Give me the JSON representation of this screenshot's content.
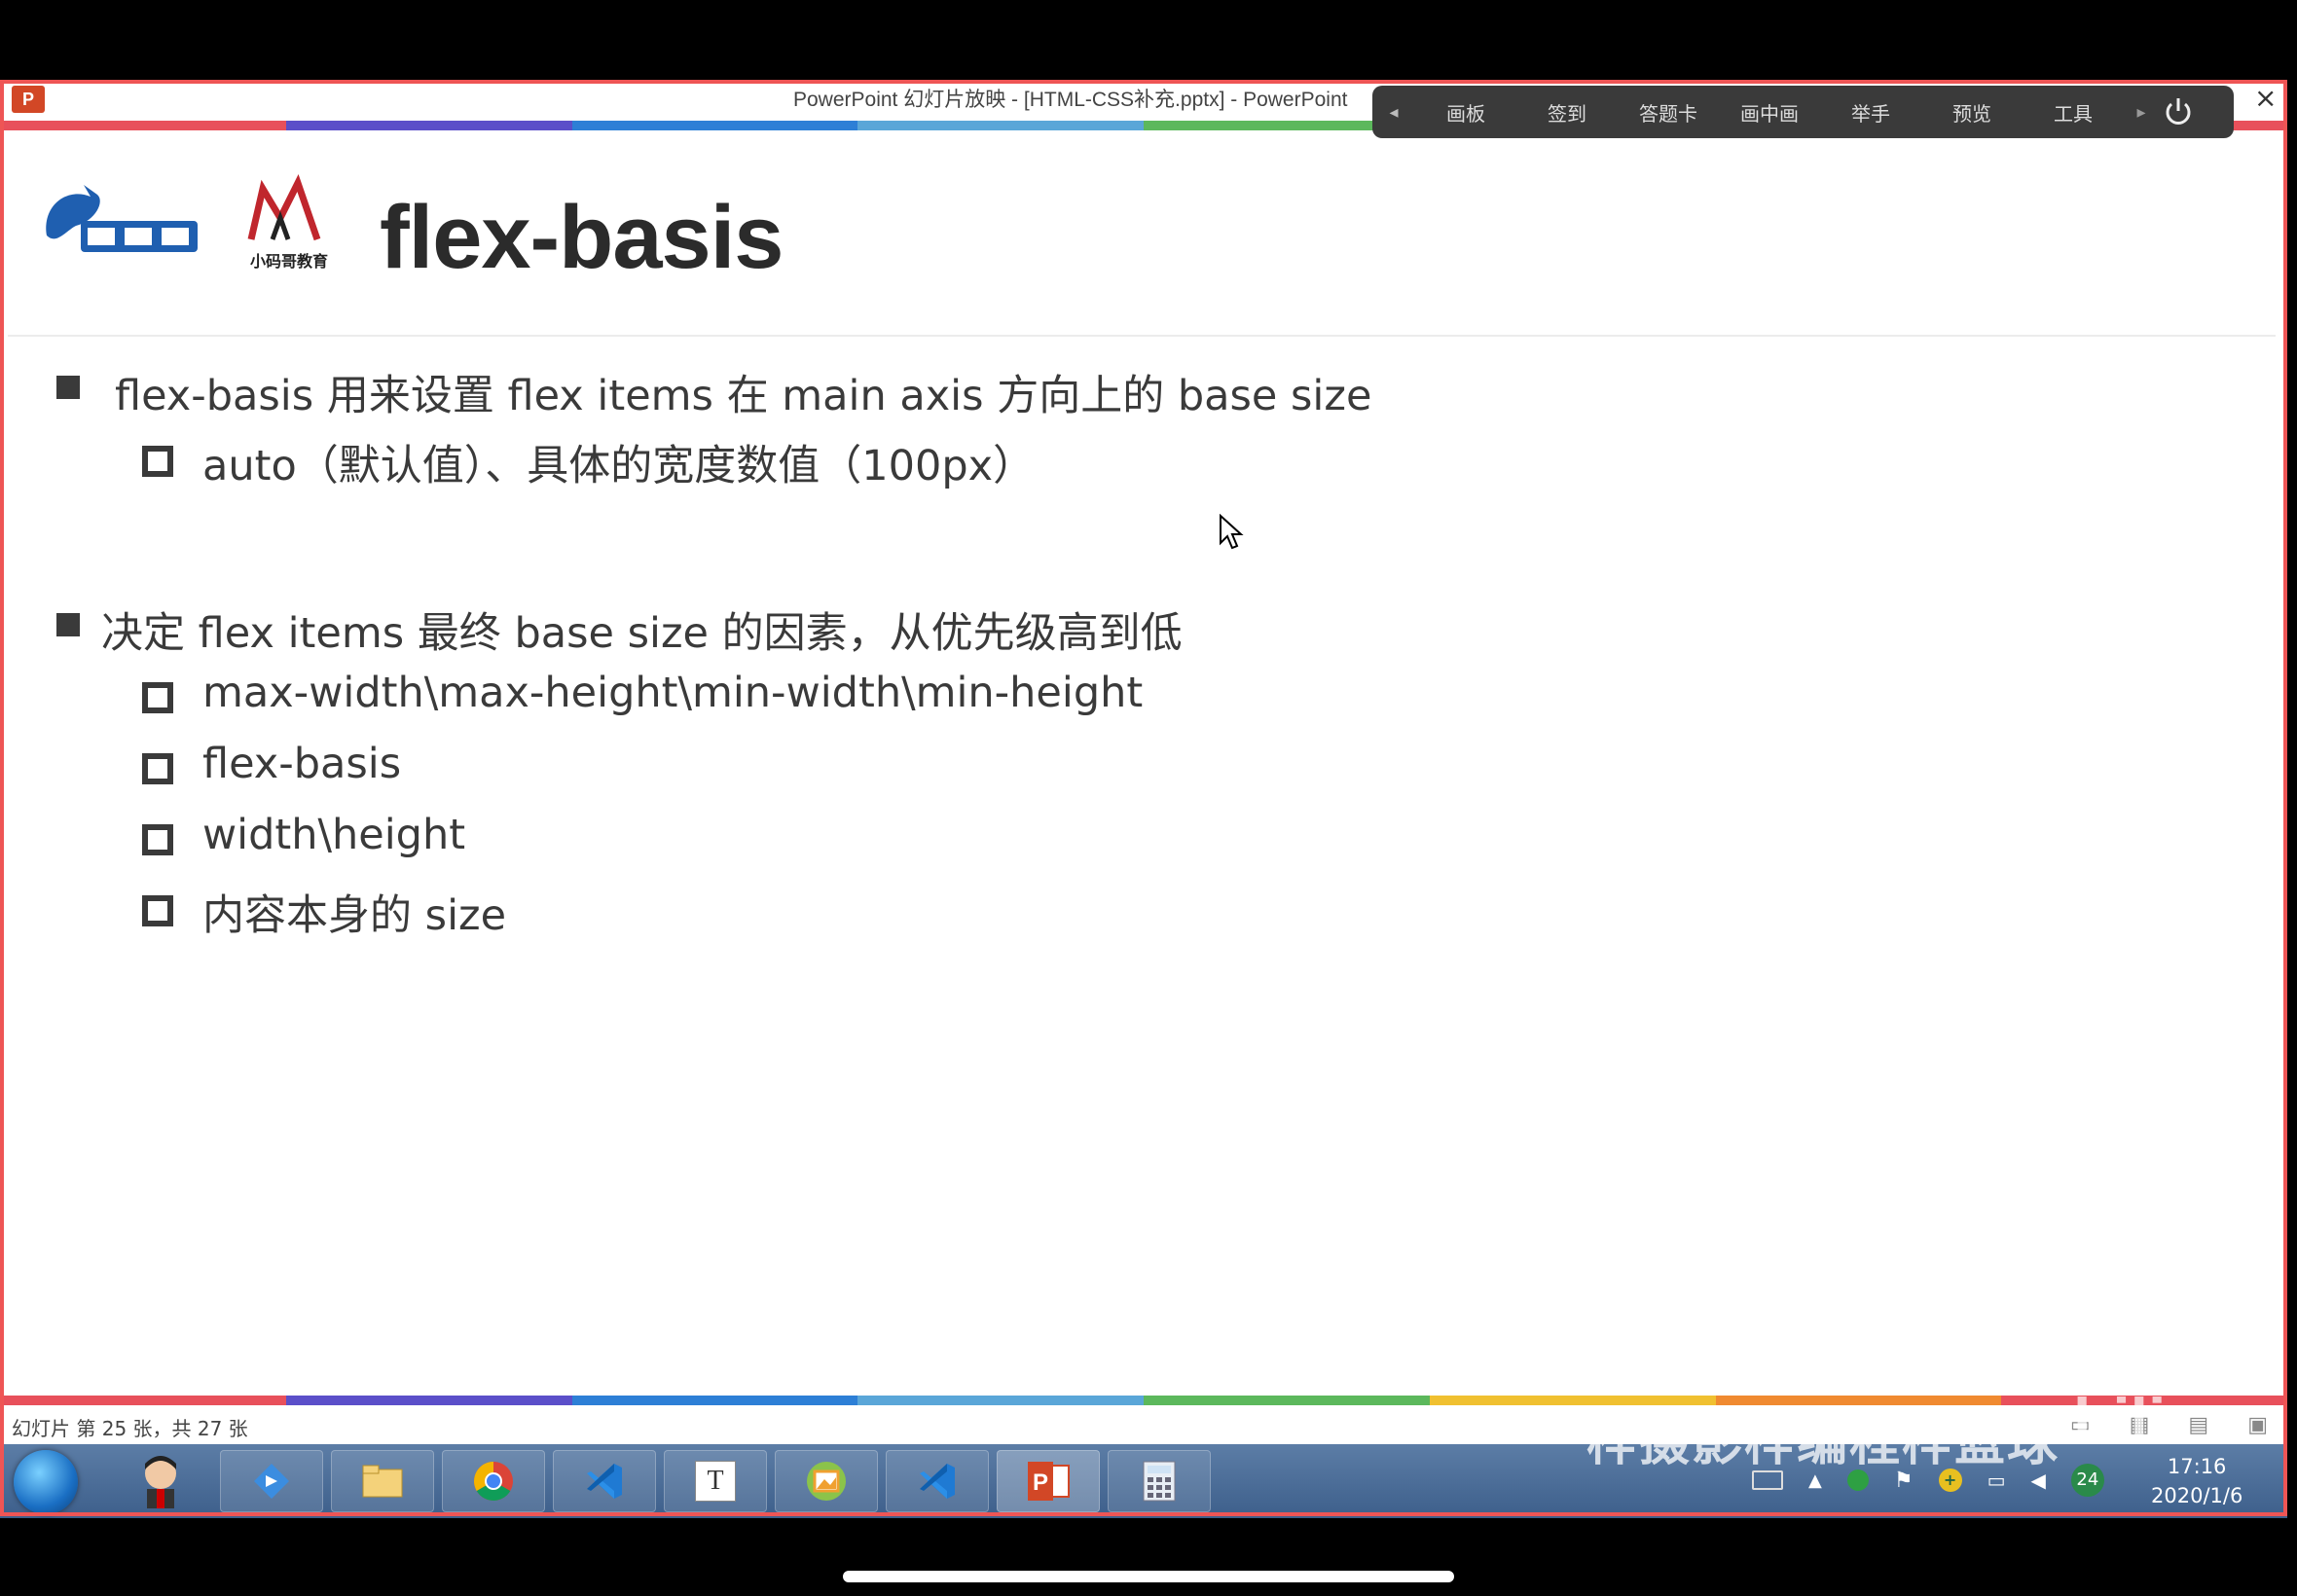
{
  "window": {
    "title": "PowerPoint 幻灯片放映 - [HTML-CSS补充.pptx] - PowerPoint",
    "app_icon": "P",
    "close_label": "×"
  },
  "toolbar": {
    "items": [
      "画板",
      "签到",
      "答题卡",
      "画中画",
      "举手",
      "预览",
      "工具"
    ]
  },
  "slide": {
    "title": "flex-basis",
    "logo2_text": "小码哥教育",
    "bullets": [
      {
        "text": "flex-basis 用来设置 flex items 在 main axis 方向上的 base size",
        "children": [
          "auto（默认值）、具体的宽度数值（100px）"
        ]
      },
      {
        "text": "决定 flex items 最终 base size 的因素，从优先级高到低",
        "children": [
          "max-width\\max-height\\min-width\\min-height",
          "flex-basis",
          "width\\height",
          "内容本身的 size"
        ]
      }
    ]
  },
  "statusbar": {
    "text": "幻灯片 第 25 张，共 27 张"
  },
  "watermark": {
    "text": "梓摄影梓编程梓篮球",
    "bili": "bili"
  },
  "taskbar": {
    "clock_time": "17:16",
    "clock_date": "2020/1/6",
    "badge": "24",
    "t_app_label": "T"
  },
  "colors": {
    "stripe": [
      "#e8505b",
      "#5b4fc9",
      "#2d7fd6",
      "#5aa6d8",
      "#5cb85c",
      "#f0c030",
      "#f08a30",
      "#e8505b"
    ],
    "text": "#3a3a3a"
  }
}
